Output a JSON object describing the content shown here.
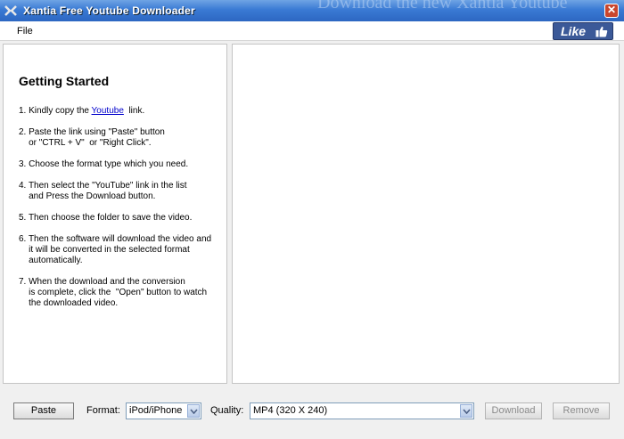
{
  "window": {
    "title": "Xantia Free Youtube Downloader",
    "background_text": "Download the new Xantia Youtube"
  },
  "menu": {
    "file_label": "File"
  },
  "like_button": {
    "label": "Like",
    "icon": "thumbs-up-icon",
    "color": "#3b5998"
  },
  "getting_started": {
    "title": "Getting Started",
    "step1_prefix": "1. Kindly copy the ",
    "step1_link": "Youtube",
    "step1_suffix": "  link.",
    "step2": "2. Paste the link using \"Paste\" button\n    or \"CTRL + V\"  or \"Right Click\".",
    "step3": "3. Choose the format type which you need.",
    "step4": "4. Then select the \"YouTube\" link in the list\n    and Press the Download button.",
    "step5": "5. Then choose the folder to save the video.",
    "step6": "6. Then the software will download the video and\n    it will be converted in the selected format\n    automatically.",
    "step7": "7. When the download and the conversion\n    is complete, click the  \"Open\" button to watch\n    the downloaded video."
  },
  "toolbar": {
    "paste_label": "Paste",
    "format_label": "Format:",
    "format_value": "iPod/iPhone",
    "quality_label": "Quality:",
    "quality_value": "MP4 (320 X 240)",
    "download_label": "Download",
    "remove_label": "Remove"
  }
}
